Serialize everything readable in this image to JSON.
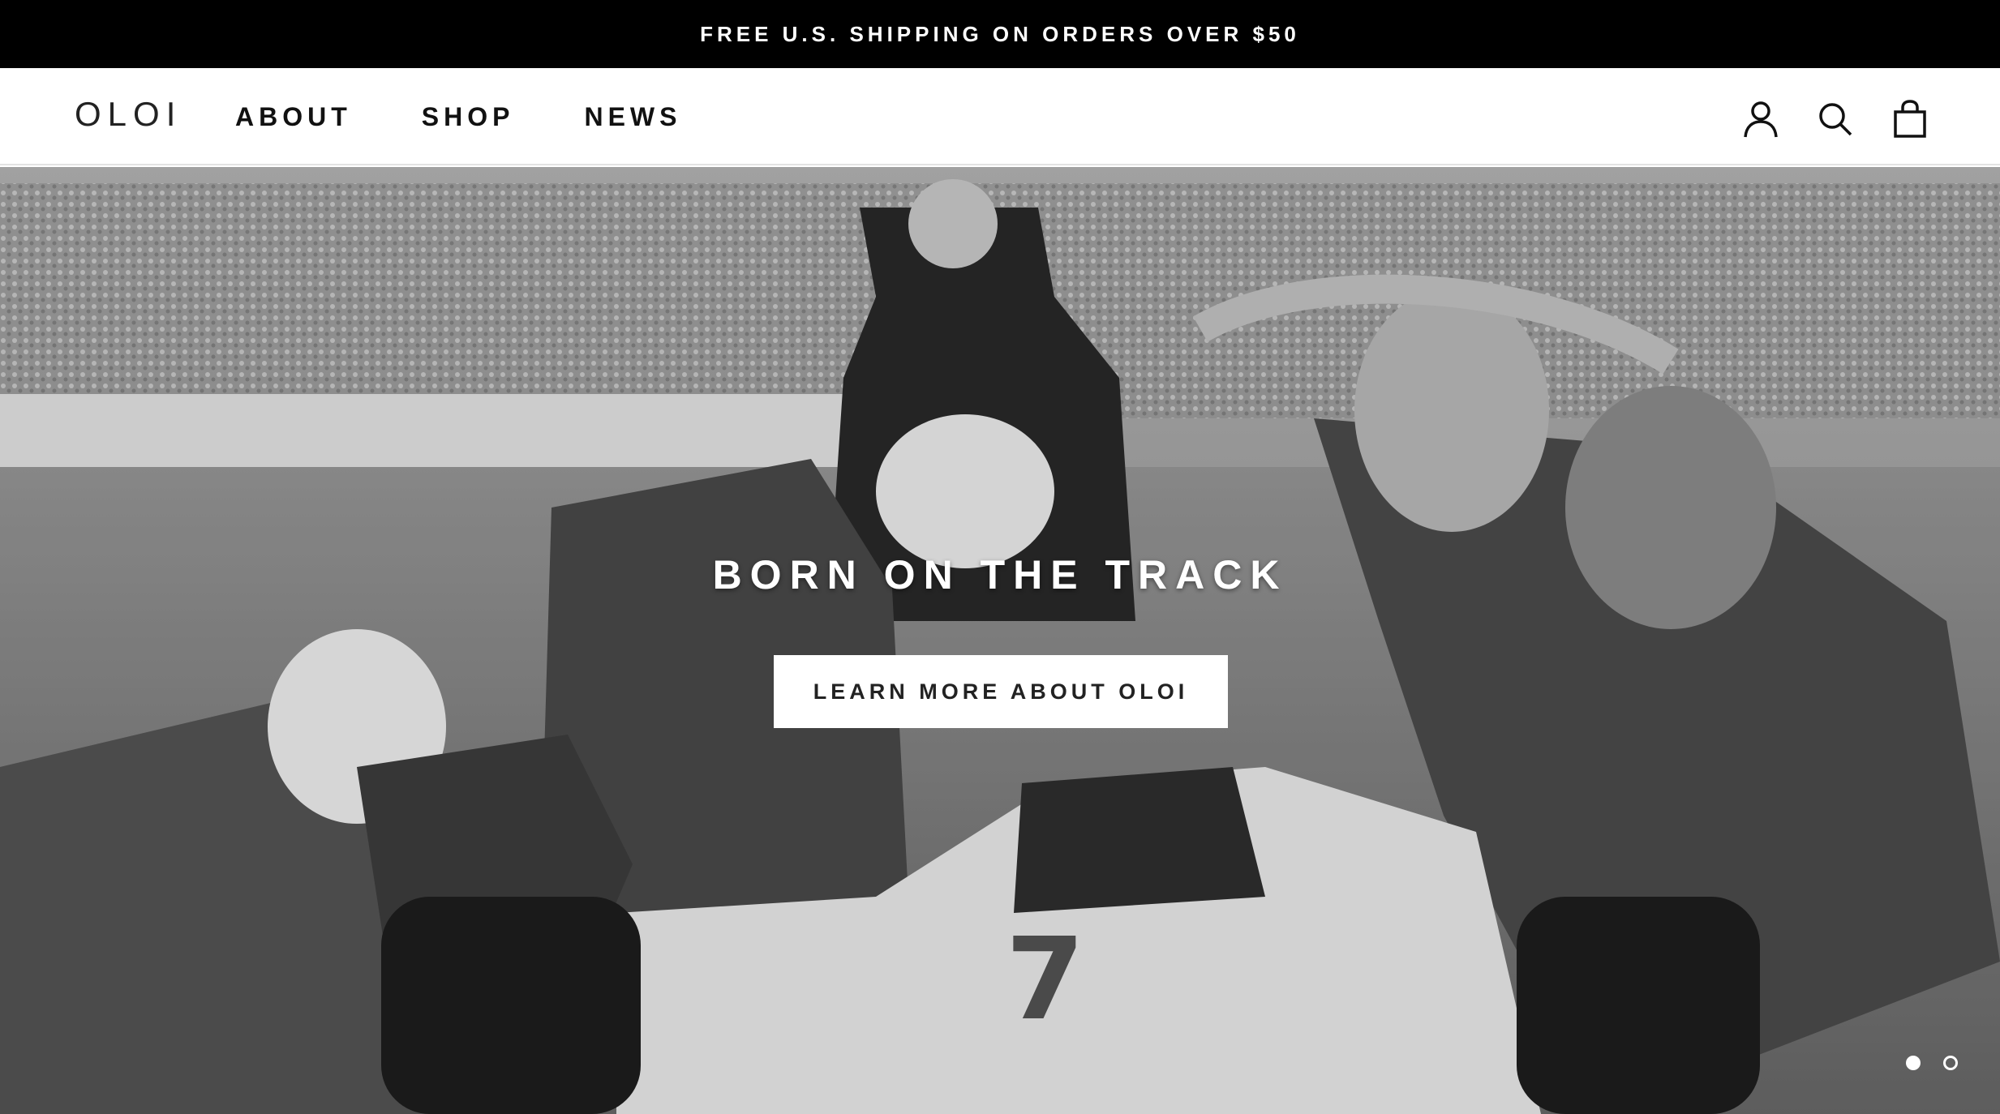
{
  "announcement": {
    "text": "FREE U.S. SHIPPING ON ORDERS OVER $50"
  },
  "header": {
    "logo": "OLOI",
    "nav": [
      {
        "label": "ABOUT"
      },
      {
        "label": "SHOP"
      },
      {
        "label": "NEWS"
      }
    ],
    "icons": [
      "account-icon",
      "search-icon",
      "cart-icon"
    ]
  },
  "hero": {
    "image": "black-and-white race car pit stop photograph",
    "title": "BORN ON THE TRACK",
    "button_label": "LEARN MORE ABOUT OLOI",
    "slides_total": 2,
    "active_slide": 1
  },
  "colors": {
    "announcement_bg": "#000000",
    "header_bg": "#ffffff",
    "text": "#111111",
    "hero_overlay_text": "#ffffff"
  }
}
